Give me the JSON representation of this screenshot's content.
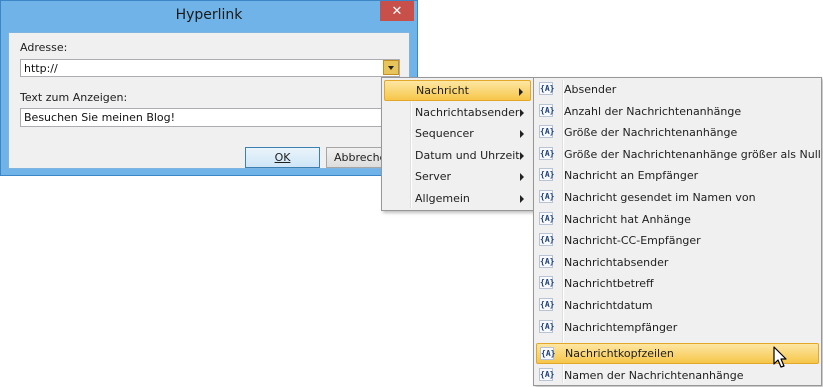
{
  "dialog": {
    "title": "Hyperlink",
    "close_glyph": "✕",
    "address_label": "Adresse:",
    "address_value": "http://",
    "display_text_label": "Text zum Anzeigen:",
    "display_text_value": "Besuchen Sie meinen Blog!",
    "ok_label": "OK",
    "cancel_label": "Abbrechen"
  },
  "menu": {
    "items": [
      {
        "label": "Nachricht",
        "highlighted": true
      },
      {
        "label": "Nachrichtabsender"
      },
      {
        "label": "Sequencer"
      },
      {
        "label": "Datum und Uhrzeit"
      },
      {
        "label": "Server"
      },
      {
        "label": "Allgemein"
      }
    ]
  },
  "submenu": {
    "icon_glyph": "{A}",
    "items": [
      {
        "label": "Absender"
      },
      {
        "label": "Anzahl der Nachrichtenanhänge"
      },
      {
        "label": "Größe der Nachrichtenanhänge"
      },
      {
        "label": "Größe der Nachrichtenanhänge größer als Null"
      },
      {
        "label": "Nachricht an Empfänger"
      },
      {
        "label": "Nachricht gesendet im Namen von"
      },
      {
        "label": "Nachricht hat Anhänge"
      },
      {
        "label": "Nachricht-CC-Empfänger"
      },
      {
        "label": "Nachrichtabsender"
      },
      {
        "label": "Nachrichtbetreff"
      },
      {
        "label": "Nachrichtdatum"
      },
      {
        "label": "Nachrichtempfänger"
      },
      {
        "label": "Nachrichtkopfzeilen",
        "highlighted": true
      },
      {
        "label": "Namen der Nachrichtenanhänge"
      }
    ]
  },
  "colors": {
    "dialog_frame": "#6fb3e8",
    "highlight": "#f6c64a",
    "close_button": "#c7504a"
  }
}
